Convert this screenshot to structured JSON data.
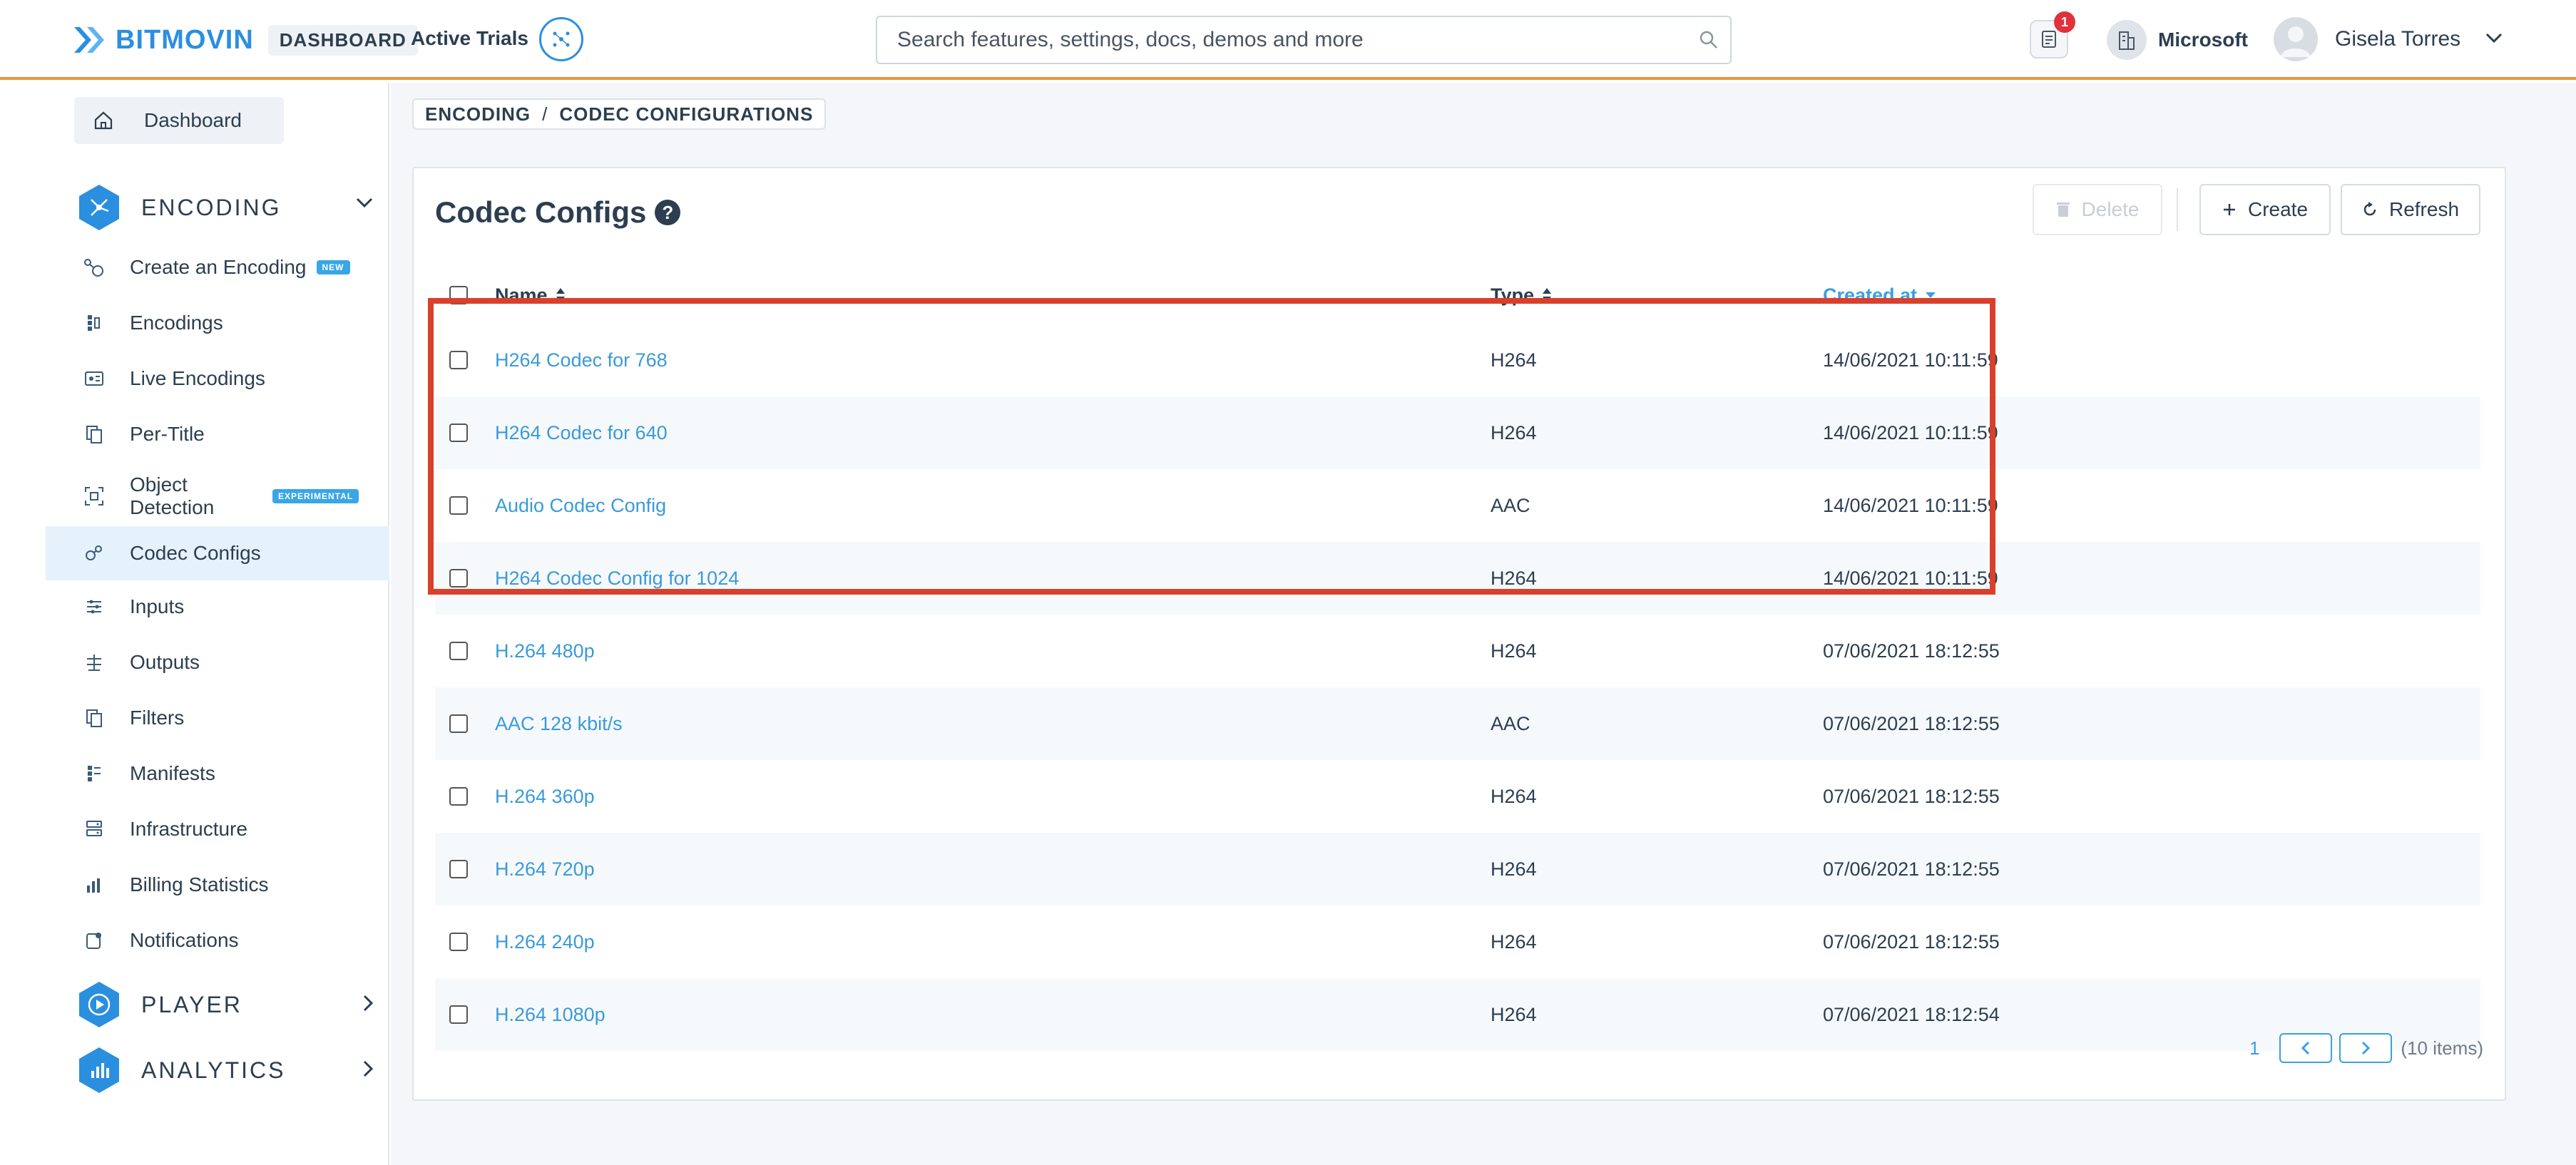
{
  "header": {
    "brand": "BITMOVIN",
    "brand_badge": "DASHBOARD",
    "active_trials": "Active Trials",
    "search_placeholder": "Search features, settings, docs, demos and more",
    "notification_count": "1",
    "organization": "Microsoft",
    "user_name": "Gisela Torres",
    "accent_color": "#e8963e"
  },
  "sidebar": {
    "dashboard": "Dashboard",
    "sections": {
      "encoding": "ENCODING",
      "player": "PLAYER",
      "analytics": "ANALYTICS"
    },
    "items": [
      {
        "label": "Create an Encoding",
        "tag": "NEW",
        "icon": "create-encoding-icon"
      },
      {
        "label": "Encodings",
        "icon": "encodings-icon"
      },
      {
        "label": "Live Encodings",
        "icon": "live-encodings-icon"
      },
      {
        "label": "Per-Title",
        "icon": "per-title-icon"
      },
      {
        "label": "Object\nDetection",
        "tag": "EXPERIMENTAL",
        "icon": "object-detection-icon"
      },
      {
        "label": "Codec Configs",
        "icon": "codec-configs-icon",
        "active": true
      },
      {
        "label": "Inputs",
        "icon": "inputs-icon"
      },
      {
        "label": "Outputs",
        "icon": "outputs-icon"
      },
      {
        "label": "Filters",
        "icon": "filters-icon"
      },
      {
        "label": "Manifests",
        "icon": "manifests-icon"
      },
      {
        "label": "Infrastructure",
        "icon": "infrastructure-icon"
      },
      {
        "label": "Billing Statistics",
        "icon": "billing-icon"
      },
      {
        "label": "Notifications",
        "icon": "notifications-icon"
      }
    ]
  },
  "breadcrumb": {
    "first": "ENCODING",
    "separator": "/",
    "second": "CODEC CONFIGURATIONS"
  },
  "page": {
    "title": "Codec Configs",
    "help": "?",
    "buttons": {
      "delete": "Delete",
      "create": "Create",
      "refresh": "Refresh"
    }
  },
  "table": {
    "columns": {
      "name": "Name",
      "type": "Type",
      "created": "Created at"
    },
    "rows": [
      {
        "name": "H264 Codec for 768",
        "type": "H264",
        "created": "14/06/2021 10:11:59"
      },
      {
        "name": "H264 Codec for 640",
        "type": "H264",
        "created": "14/06/2021 10:11:59"
      },
      {
        "name": "Audio Codec Config",
        "type": "AAC",
        "created": "14/06/2021 10:11:59"
      },
      {
        "name": "H264 Codec Config for 1024",
        "type": "H264",
        "created": "14/06/2021 10:11:59"
      },
      {
        "name": "H.264 480p",
        "type": "H264",
        "created": "07/06/2021 18:12:55"
      },
      {
        "name": "AAC 128 kbit/s",
        "type": "AAC",
        "created": "07/06/2021 18:12:55"
      },
      {
        "name": "H.264 360p",
        "type": "H264",
        "created": "07/06/2021 18:12:55"
      },
      {
        "name": "H.264 720p",
        "type": "H264",
        "created": "07/06/2021 18:12:55"
      },
      {
        "name": "H.264 240p",
        "type": "H264",
        "created": "07/06/2021 18:12:55"
      },
      {
        "name": "H.264 1080p",
        "type": "H264",
        "created": "07/06/2021 18:12:54"
      }
    ]
  },
  "pagination": {
    "page": "1",
    "count": "(10 items)"
  },
  "colors": {
    "link": "#3a9ad9",
    "highlight_border": "#d9402b",
    "brand_blue": "#2b8fe0"
  }
}
